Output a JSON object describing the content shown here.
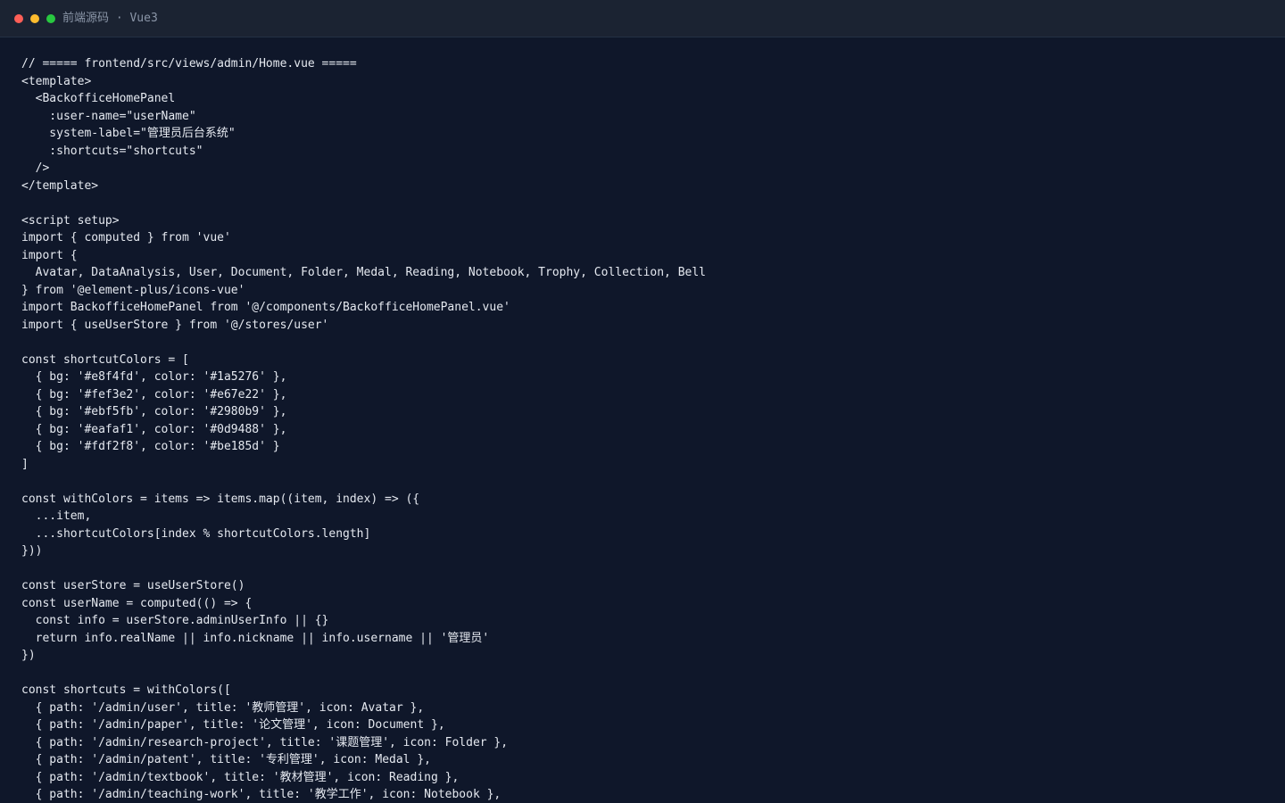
{
  "window": {
    "title": "前端源码 · Vue3"
  },
  "editor": {
    "lines": [
      "// ===== frontend/src/views/admin/Home.vue =====",
      "<template>",
      "  <BackofficeHomePanel",
      "    :user-name=\"userName\"",
      "    system-label=\"管理员后台系统\"",
      "    :shortcuts=\"shortcuts\"",
      "  />",
      "</template>",
      "",
      "<script setup>",
      "import { computed } from 'vue'",
      "import {",
      "  Avatar, DataAnalysis, User, Document, Folder, Medal, Reading, Notebook, Trophy, Collection, Bell",
      "} from '@element-plus/icons-vue'",
      "import BackofficeHomePanel from '@/components/BackofficeHomePanel.vue'",
      "import { useUserStore } from '@/stores/user'",
      "",
      "const shortcutColors = [",
      "  { bg: '#e8f4fd', color: '#1a5276' },",
      "  { bg: '#fef3e2', color: '#e67e22' },",
      "  { bg: '#ebf5fb', color: '#2980b9' },",
      "  { bg: '#eafaf1', color: '#0d9488' },",
      "  { bg: '#fdf2f8', color: '#be185d' }",
      "]",
      "",
      "const withColors = items => items.map((item, index) => ({",
      "  ...item,",
      "  ...shortcutColors[index % shortcutColors.length]",
      "}))",
      "",
      "const userStore = useUserStore()",
      "const userName = computed(() => {",
      "  const info = userStore.adminUserInfo || {}",
      "  return info.realName || info.nickname || info.username || '管理员'",
      "})",
      "",
      "const shortcuts = withColors([",
      "  { path: '/admin/user', title: '教师管理', icon: Avatar },",
      "  { path: '/admin/paper', title: '论文管理', icon: Document },",
      "  { path: '/admin/research-project', title: '课题管理', icon: Folder },",
      "  { path: '/admin/patent', title: '专利管理', icon: Medal },",
      "  { path: '/admin/textbook', title: '教材管理', icon: Reading },",
      "  { path: '/admin/teaching-work', title: '教学工作', icon: Notebook },"
    ]
  }
}
